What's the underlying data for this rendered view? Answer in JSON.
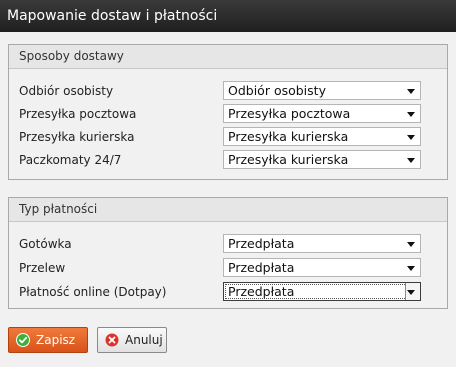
{
  "window": {
    "title": "Mapowanie dostaw i płatności"
  },
  "delivery": {
    "legend": "Sposoby dostawy",
    "rows": [
      {
        "label": "Odbiór osobisty",
        "value": "Odbiór osobisty"
      },
      {
        "label": "Przesyłka pocztowa",
        "value": "Przesyłka pocztowa"
      },
      {
        "label": "Przesyłka kurierska",
        "value": "Przesyłka kurierska"
      },
      {
        "label": "Paczkomaty 24/7",
        "value": "Przesyłka kurierska"
      }
    ]
  },
  "payment": {
    "legend": "Typ płatności",
    "rows": [
      {
        "label": "Gotówka",
        "value": "Przedpłata"
      },
      {
        "label": "Przelew",
        "value": "Przedpłata"
      },
      {
        "label": "Płatność online (Dotpay)",
        "value": "Przedpłata"
      }
    ]
  },
  "buttons": {
    "save_label": "Zapisz",
    "cancel_label": "Anuluj",
    "save_icon": "check-circle-icon",
    "cancel_icon": "x-circle-icon"
  },
  "colors": {
    "save_bg": "#e8662a",
    "check_icon": "#3bb03b",
    "cancel_icon": "#d9342b"
  }
}
